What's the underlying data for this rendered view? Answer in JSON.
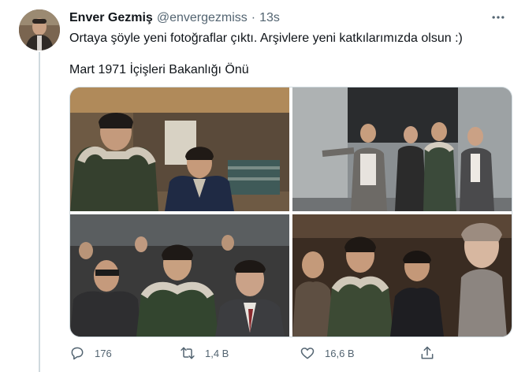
{
  "tweet": {
    "author_name": "Enver Gezmiş",
    "handle": "@envergezmiss",
    "separator": "·",
    "time": "13s",
    "text_line1": "Ortaya şöyle yeni fotoğraflar çıktı. Arşivlere yeni katkılarımızda olsun :)",
    "text_line2": "Mart 1971 İçişleri Bakanlığı Önü",
    "photos": [
      "photo-1",
      "photo-2",
      "photo-3",
      "photo-4"
    ],
    "actions": {
      "reply_count": "176",
      "retweet_count": "1,4 B",
      "like_count": "16,6 B"
    }
  },
  "icons": [
    "more-icon",
    "reply-icon",
    "retweet-icon",
    "like-icon",
    "share-icon"
  ],
  "colors": {
    "text": "#0f1419",
    "secondary": "#536471",
    "border": "#cfd9de"
  }
}
